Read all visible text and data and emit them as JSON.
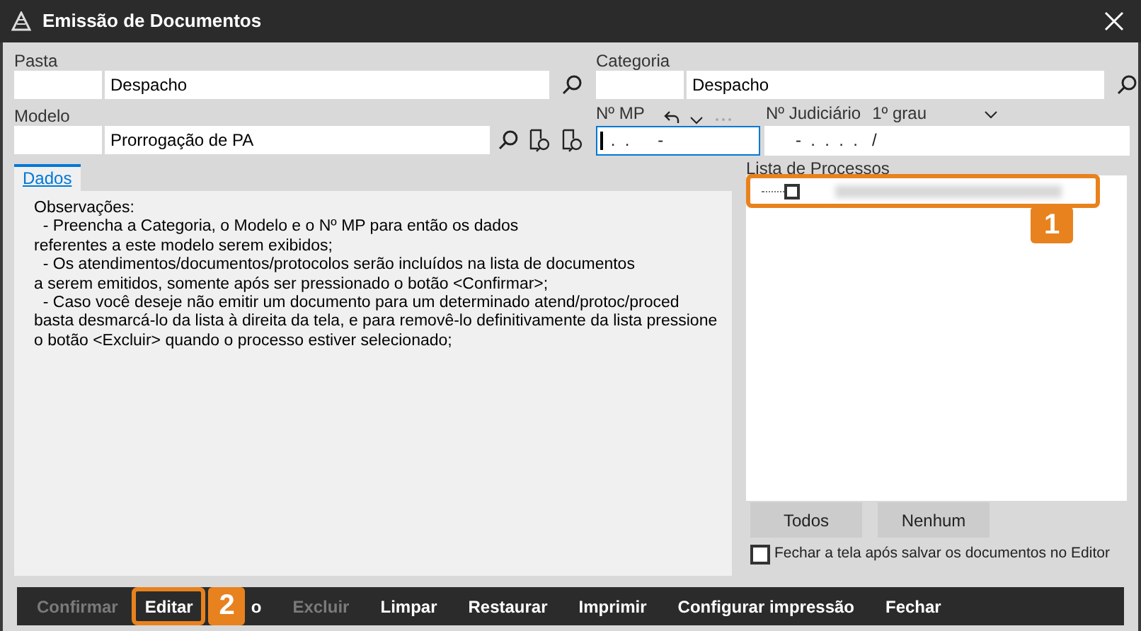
{
  "window": {
    "title": "Emissão de Documentos"
  },
  "pasta": {
    "label": "Pasta",
    "value": "Despacho"
  },
  "categoria": {
    "label": "Categoria",
    "value": "Despacho"
  },
  "modelo": {
    "label": "Modelo",
    "value": "Prorrogação de PA"
  },
  "mp": {
    "label": "Nº MP",
    "value": " .  .      -",
    "focused": true
  },
  "judiciario": {
    "label": "Nº Judiciário",
    "grau": "1º grau",
    "value": "      -  .  .  .  .   /"
  },
  "tabs": [
    {
      "label": "Dados",
      "selected": true
    }
  ],
  "observacoes": [
    "Observações:",
    "  - Preencha a Categoria, o Modelo e o Nº MP para então os dados",
    "referentes a este modelo serem exibidos;",
    "  - Os atendimentos/documentos/protocolos serão incluídos na lista de documentos",
    "a serem emitidos, somente após ser pressionado o botão <Confirmar>;",
    "  - Caso você deseje não emitir um documento para um determinado atend/protoc/proced",
    "basta desmarcá-lo da lista à direita da tela, e para removê-lo definitivamente da lista pressione",
    "o botão <Excluir> quando o processo estiver selecionado;"
  ],
  "lista": {
    "label": "Lista de Processos",
    "items": [
      {
        "checked": false
      }
    ]
  },
  "list_buttons": [
    "Todos",
    "Nenhum"
  ],
  "fechar_checkbox": {
    "label": "Fechar a tela após salvar os documentos no Editor",
    "checked": false
  },
  "callouts": [
    "1",
    "2"
  ],
  "toolbar": [
    {
      "label": "Confirmar",
      "disabled": true
    },
    {
      "label": "Editar",
      "disabled": false
    },
    {
      "label": "o",
      "disabled": false
    },
    {
      "label": "Excluir",
      "disabled": true
    },
    {
      "label": "Limpar",
      "disabled": false
    },
    {
      "label": "Restaurar",
      "disabled": false
    },
    {
      "label": "Imprimir",
      "disabled": false
    },
    {
      "label": "Configurar impressão",
      "disabled": false
    },
    {
      "label": "Fechar",
      "disabled": false
    }
  ]
}
